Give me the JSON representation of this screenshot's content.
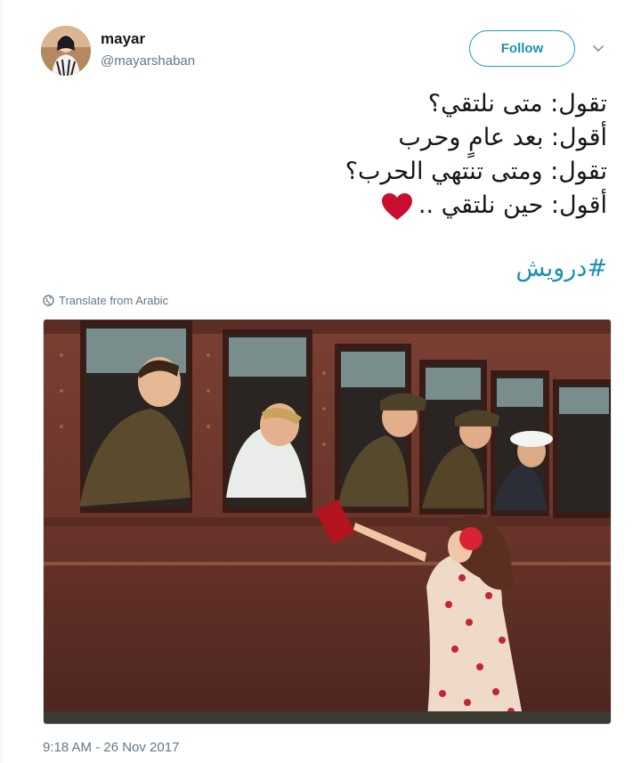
{
  "user": {
    "display_name": "mayar",
    "handle": "@mayarshaban",
    "avatar_icon": "profile-photo"
  },
  "actions": {
    "follow_label": "Follow",
    "more_icon": "chevron-down-icon"
  },
  "tweet": {
    "lines": [
      "تقول: متى نلتقي؟",
      "أقول: بعد عامٍ وحرب",
      "تقول: ومتى تنتهي الحرب؟",
      "أقول: حين نلتقي .."
    ],
    "emoji": "red-heart",
    "hashtag": "#درويش",
    "translate_label": "Translate from Arabic",
    "timestamp": "9:18 AM - 26 Nov 2017"
  },
  "colors": {
    "accent": "#1a91b3",
    "heart": "#c8102e",
    "muted": "#657786"
  }
}
